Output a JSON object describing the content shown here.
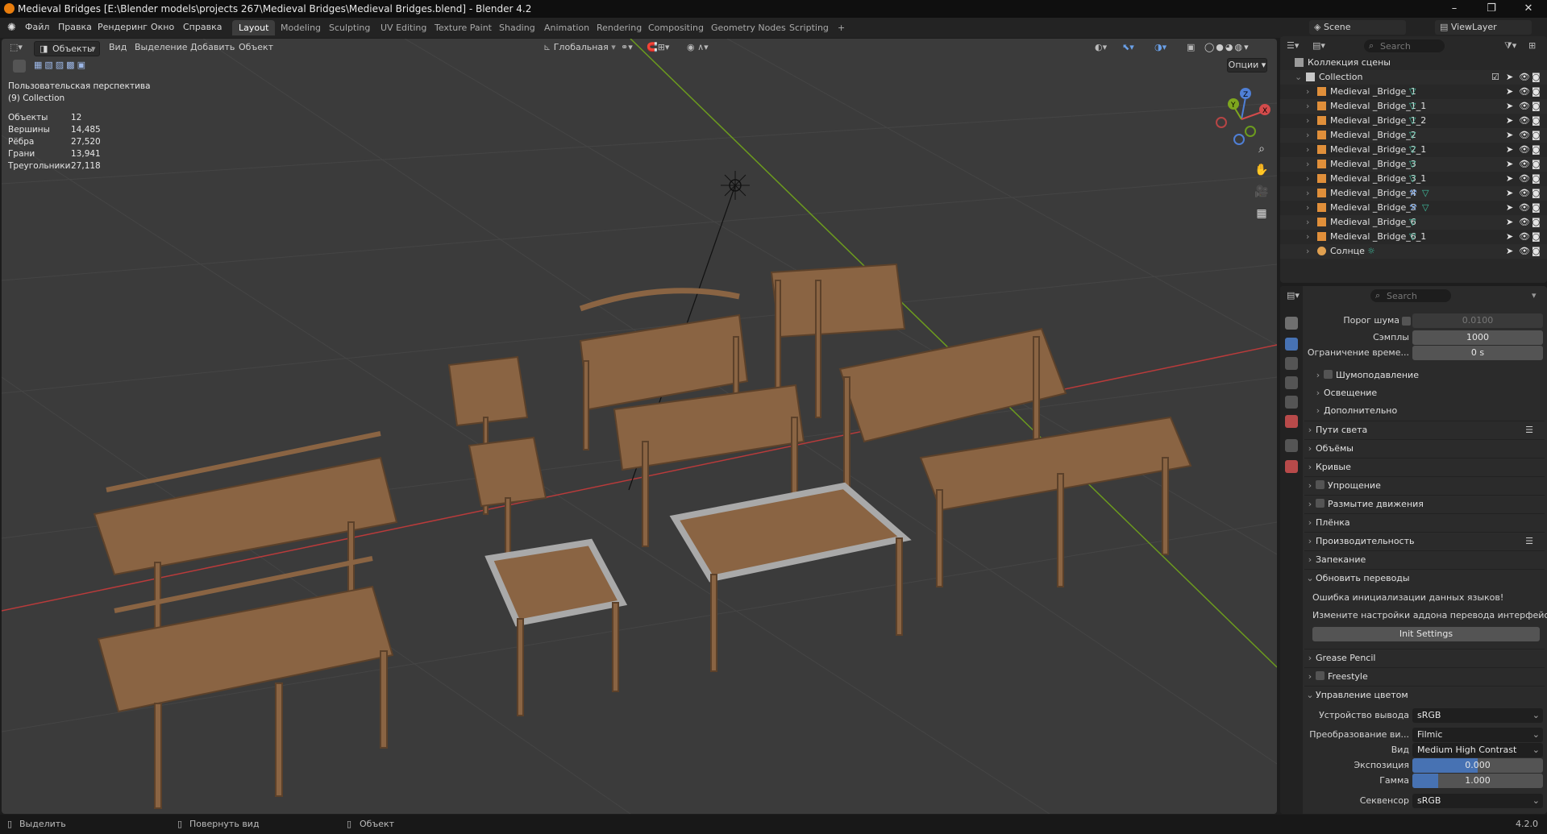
{
  "window": {
    "title": "Medieval Bridges [E:\\Blender models\\projects 267\\Medieval Bridges\\Medieval Bridges.blend] - Blender 4.2",
    "controls": [
      "–",
      "❐",
      "✕"
    ]
  },
  "menu": {
    "items": [
      "Файл",
      "Правка",
      "Рендеринг",
      "Окно",
      "Справка"
    ],
    "workspaces": [
      "Layout",
      "Modeling",
      "Sculpting",
      "UV Editing",
      "Texture Paint",
      "Shading",
      "Animation",
      "Rendering",
      "Compositing",
      "Geometry Nodes",
      "Scripting",
      "+"
    ],
    "active_workspace": "Layout",
    "scene": "Scene",
    "view_layer": "ViewLayer"
  },
  "viewport": {
    "mode": "Объекты",
    "menus": [
      "Вид",
      "Выделение",
      "Добавить",
      "Объект"
    ],
    "transform_orientation": "Глобальная",
    "options_label": "Опции",
    "view_name": "Пользовательская перспектива",
    "collection_info": "(9) Collection",
    "stats": [
      {
        "label": "Объекты",
        "value": "12"
      },
      {
        "label": "Вершины",
        "value": "14,485"
      },
      {
        "label": "Рёбра",
        "value": "27,520"
      },
      {
        "label": "Грани",
        "value": "13,941"
      },
      {
        "label": "Треугольники",
        "value": "27,118"
      }
    ],
    "gizmo_axes": [
      "Z",
      "Y",
      "X"
    ]
  },
  "outliner": {
    "search_placeholder": "Search",
    "scene_collection": "Коллекция сцены",
    "collection": "Collection",
    "objects": [
      {
        "name": "Medieval _Bridge_1",
        "modifier": false
      },
      {
        "name": "Medieval _Bridge_1_1",
        "modifier": false
      },
      {
        "name": "Medieval _Bridge_1_2",
        "modifier": false
      },
      {
        "name": "Medieval _Bridge_2",
        "modifier": false
      },
      {
        "name": "Medieval _Bridge_2_1",
        "modifier": false
      },
      {
        "name": "Medieval _Bridge_3",
        "modifier": false
      },
      {
        "name": "Medieval _Bridge_3_1",
        "modifier": false
      },
      {
        "name": "Medieval _Bridge_4",
        "modifier": true
      },
      {
        "name": "Medieval _Bridge_5",
        "modifier": true
      },
      {
        "name": "Medieval _Bridge_6",
        "modifier": false
      },
      {
        "name": "Medieval _Bridge_6_1",
        "modifier": false
      },
      {
        "name": "Солнце",
        "modifier": false
      }
    ]
  },
  "properties": {
    "search_placeholder": "Search",
    "noise_threshold_label": "Порог шума",
    "noise_threshold_value": "0.0100",
    "samples_label": "Сэмплы",
    "samples_value": "1000",
    "time_limit_label": "Ограничение време...",
    "time_limit_value": "0 s",
    "sub_sections": [
      "Шумоподавление",
      "Освещение",
      "Дополнительно"
    ],
    "sections": [
      "Пути света",
      "Объёмы",
      "Кривые",
      "Упрощение",
      "Размытие движения",
      "Плёнка",
      "Производительность",
      "Запекание"
    ],
    "translate_section": "Обновить переводы",
    "translate_error": "Ошибка инициализации данных языков!",
    "translate_hint": "Измените настройки аддона перевода интерфейса",
    "init_settings": "Init Settings",
    "grease_pencil": "Grease Pencil",
    "freestyle": "Freestyle",
    "color_mgmt": "Управление цветом",
    "display_device_label": "Устройство вывода",
    "display_device_value": "sRGB",
    "view_transform_label": "Преобразование ви...",
    "view_transform_value": "Filmic",
    "look_label": "Вид",
    "look_value": "Medium High Contrast",
    "exposure_label": "Экспозиция",
    "exposure_value": "0.000",
    "gamma_label": "Гамма",
    "gamma_value": "1.000",
    "sequencer_label": "Секвенсор",
    "sequencer_value": "sRGB"
  },
  "statusbar": {
    "select": "Выделить",
    "rotate": "Повернуть вид",
    "object": "Объект",
    "version": "4.2.0"
  },
  "colors": {
    "accent": "#4772b3",
    "wood": "#8a6443",
    "x_axis": "#b83b3b",
    "y_axis": "#6c9b1e"
  }
}
